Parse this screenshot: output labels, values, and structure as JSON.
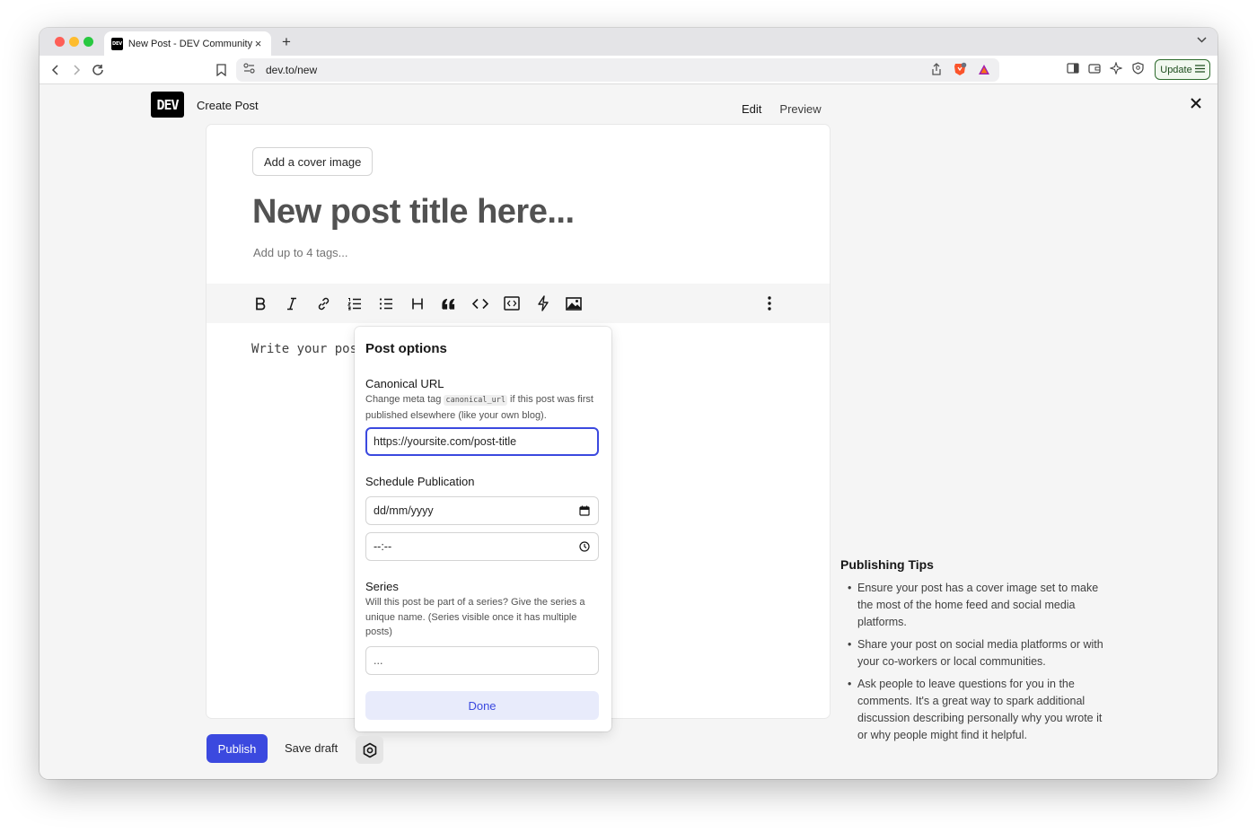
{
  "browser": {
    "tab": {
      "favicon_text": "DEV",
      "title": "New Post - DEV Community",
      "close": "×",
      "new_tab": "+"
    },
    "address": {
      "url": "dev.to/new"
    },
    "update_label": "Update"
  },
  "header": {
    "logo": "DEV",
    "title": "Create Post",
    "tabs": {
      "edit": "Edit",
      "preview": "Preview"
    }
  },
  "editor": {
    "cover_button": "Add a cover image",
    "title_placeholder": "New post title here...",
    "tags_placeholder": "Add up to 4 tags...",
    "body_placeholder": "Write your pos",
    "toolbar": [
      "bold-icon",
      "italic-icon",
      "link-icon",
      "ordered-list-icon",
      "unordered-list-icon",
      "heading-icon",
      "quote-icon",
      "code-icon",
      "code-block-icon",
      "lightning-icon",
      "image-icon",
      "more-vertical-icon"
    ]
  },
  "post_options": {
    "title": "Post options",
    "canonical": {
      "label": "Canonical URL",
      "desc_before": "Change meta tag ",
      "desc_code": "canonical_url",
      "desc_after": " if this post was first published elsewhere (like your own blog).",
      "value": "https://yoursite.com/post-title"
    },
    "schedule": {
      "label": "Schedule Publication",
      "date_placeholder": "dd/mm/yyyy",
      "time_placeholder": "--:--"
    },
    "series": {
      "label": "Series",
      "desc": "Will this post be part of a series? Give the series a unique name. (Series visible once it has multiple posts)",
      "placeholder": "..."
    },
    "done": "Done"
  },
  "actions": {
    "publish": "Publish",
    "save_draft": "Save draft"
  },
  "tips": {
    "title": "Publishing Tips",
    "items": [
      "Ensure your post has a cover image set to make the most of the home feed and social media platforms.",
      "Share your post on social media platforms or with your co-workers or local communities.",
      "Ask people to leave questions for you in the comments. It's a great way to spark additional discussion describing personally why you wrote it or why people might find it helpful."
    ]
  },
  "colors": {
    "accent": "#3b49df",
    "done_bg": "#e8ebfb"
  }
}
